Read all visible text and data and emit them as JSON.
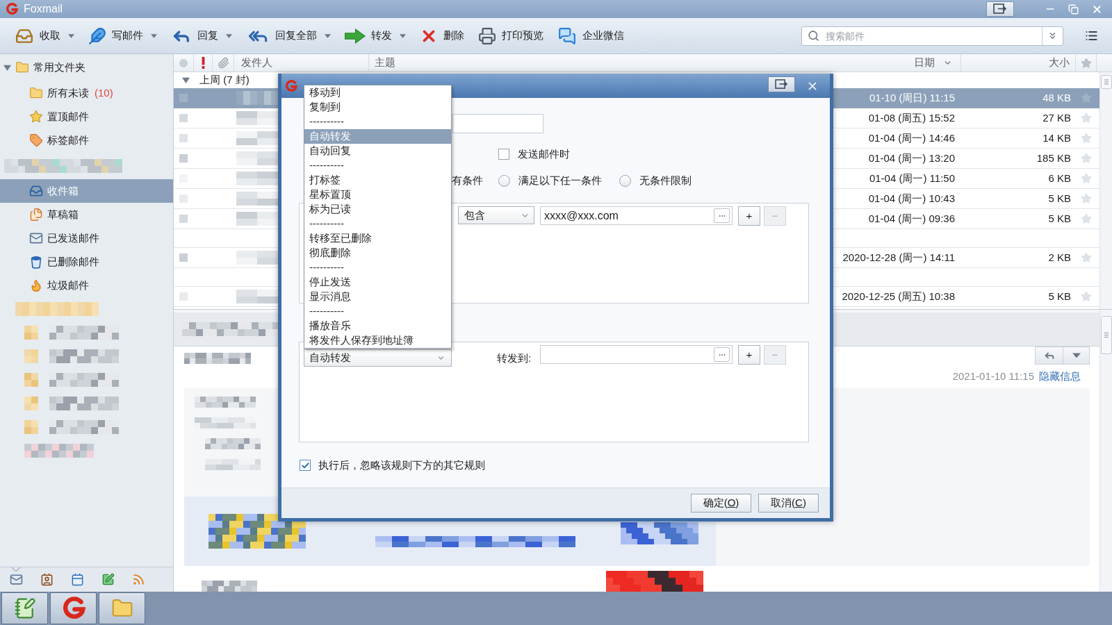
{
  "window": {
    "title": "Foxmail"
  },
  "toolbar": {
    "buttons": [
      {
        "kind": "receive",
        "label": "收取",
        "has_menu": true
      },
      {
        "kind": "compose",
        "label": "写邮件",
        "has_menu": true
      },
      {
        "kind": "reply",
        "label": "回复",
        "has_menu": true
      },
      {
        "kind": "reply_all",
        "label": "回复全部",
        "has_menu": true
      },
      {
        "kind": "forward",
        "label": "转发",
        "has_menu": true
      },
      {
        "kind": "delete",
        "label": "删除",
        "has_menu": false
      },
      {
        "kind": "print_preview",
        "label": "打印预览",
        "has_menu": false
      },
      {
        "kind": "wecom",
        "label": "企业微信",
        "has_menu": false
      }
    ],
    "search": {
      "placeholder": "搜索邮件"
    }
  },
  "sidebar": {
    "group": {
      "label": "常用文件夹",
      "expanded": true,
      "children": [
        {
          "kind": "unread",
          "label": "所有未读",
          "count": "(10)",
          "selected": false
        },
        {
          "kind": "pinned",
          "label": "置顶邮件",
          "selected": false
        },
        {
          "kind": "tagged",
          "label": "标签邮件",
          "selected": false
        }
      ]
    },
    "folders": [
      {
        "kind": "inbox",
        "label": "收件箱",
        "selected": true
      },
      {
        "kind": "drafts",
        "label": "草稿箱",
        "selected": false
      },
      {
        "kind": "sent",
        "label": "已发送邮件",
        "selected": false
      },
      {
        "kind": "deleted",
        "label": "已删除邮件",
        "selected": false
      },
      {
        "kind": "junk",
        "label": "垃圾邮件",
        "selected": false
      }
    ],
    "bottom_tabs": [
      {
        "kind": "mail",
        "selected": true
      },
      {
        "kind": "contacts",
        "selected": false
      },
      {
        "kind": "calendar",
        "selected": false
      },
      {
        "kind": "notes",
        "selected": false
      },
      {
        "kind": "rss",
        "selected": false
      }
    ]
  },
  "mail_list": {
    "columns": [
      {
        "kind": "sender",
        "label": "发件人"
      },
      {
        "kind": "subject",
        "label": "主题"
      },
      {
        "kind": "date",
        "label": "日期",
        "sorted": true
      },
      {
        "kind": "size",
        "label": "大小"
      }
    ],
    "group": {
      "label": "上周 (7 封)",
      "expanded": true
    },
    "rows": [
      {
        "kind": "mail",
        "date": "01-10 (周日) 11:15",
        "size": "48 KB",
        "selected": true,
        "starred": false
      },
      {
        "kind": "mail",
        "date": "01-08 (周五) 15:52",
        "size": "27 KB",
        "selected": false,
        "starred": false
      },
      {
        "kind": "mail",
        "date": "01-04 (周一) 14:46",
        "size": "14 KB",
        "selected": false,
        "starred": false
      },
      {
        "kind": "mail",
        "date": "01-04 (周一) 13:20",
        "size": "185 KB",
        "selected": false,
        "starred": false
      },
      {
        "kind": "mail",
        "date": "01-04 (周一) 11:50",
        "size": "6 KB",
        "selected": false,
        "starred": false
      },
      {
        "kind": "mail",
        "date": "01-04 (周一) 10:43",
        "size": "5 KB",
        "selected": false,
        "starred": false
      },
      {
        "kind": "mail",
        "date": "01-04 (周一) 09:36",
        "size": "5 KB",
        "selected": false,
        "starred": false
      },
      {
        "kind": "group"
      },
      {
        "kind": "mail",
        "date": "2020-12-28 (周一) 14:11",
        "size": "2 KB",
        "selected": false,
        "starred": false
      },
      {
        "kind": "group"
      },
      {
        "kind": "mail",
        "date": "2020-12-25 (周五) 10:38",
        "size": "5 KB",
        "selected": false,
        "starred": false
      }
    ]
  },
  "preview": {
    "date": "2021-01-10 11:15",
    "link": "隐藏信息"
  },
  "dialog": {
    "when_sending": {
      "label": "发送邮件时",
      "checked": false
    },
    "match_option_partial": "有条件",
    "match_options": [
      {
        "label": "满足以下任一条件",
        "selected": false
      },
      {
        "label": "无条件限制",
        "selected": false
      }
    ],
    "condition": {
      "operator": "包含",
      "value": "xxxx@xxx.com",
      "add": {
        "label": "+",
        "disabled": false
      },
      "remove": {
        "label": "−",
        "disabled": true
      }
    },
    "action": {
      "value": "自动转发",
      "field_label": "转发到:",
      "add": {
        "label": "+",
        "disabled": false
      },
      "remove": {
        "label": "−",
        "disabled": true
      }
    },
    "stop_rule": {
      "label": "执行后，忽略该规则下方的其它规则",
      "checked": true
    },
    "buttons": [
      {
        "before": "确定(",
        "accelerator": "O",
        "after": ")"
      },
      {
        "before": "取消(",
        "accelerator": "C",
        "after": ")"
      }
    ],
    "action_menu": {
      "open": true,
      "items": [
        {
          "kind": "item",
          "label": "移动到",
          "selected": false
        },
        {
          "kind": "item",
          "label": "复制到",
          "selected": false
        },
        {
          "kind": "separator",
          "label": "----------"
        },
        {
          "kind": "item",
          "label": "自动转发",
          "selected": true
        },
        {
          "kind": "item",
          "label": "自动回复",
          "selected": false
        },
        {
          "kind": "separator",
          "label": "----------"
        },
        {
          "kind": "item",
          "label": "打标签",
          "selected": false
        },
        {
          "kind": "item",
          "label": "星标置顶",
          "selected": false
        },
        {
          "kind": "item",
          "label": "标为已读",
          "selected": false
        },
        {
          "kind": "separator",
          "label": "----------"
        },
        {
          "kind": "item",
          "label": "转移至已删除",
          "selected": false
        },
        {
          "kind": "item",
          "label": "彻底删除",
          "selected": false
        },
        {
          "kind": "separator",
          "label": "----------"
        },
        {
          "kind": "item",
          "label": "停止发送",
          "selected": false
        },
        {
          "kind": "item",
          "label": "显示消息",
          "selected": false
        },
        {
          "kind": "separator",
          "label": "----------"
        },
        {
          "kind": "item",
          "label": "播放音乐",
          "selected": false
        },
        {
          "kind": "item",
          "label": "将发件人保存到地址簿",
          "selected": false
        }
      ]
    }
  },
  "taskbar": {
    "apps": [
      {
        "kind": "notepad"
      },
      {
        "kind": "mail_client"
      },
      {
        "kind": "folder"
      }
    ]
  }
}
